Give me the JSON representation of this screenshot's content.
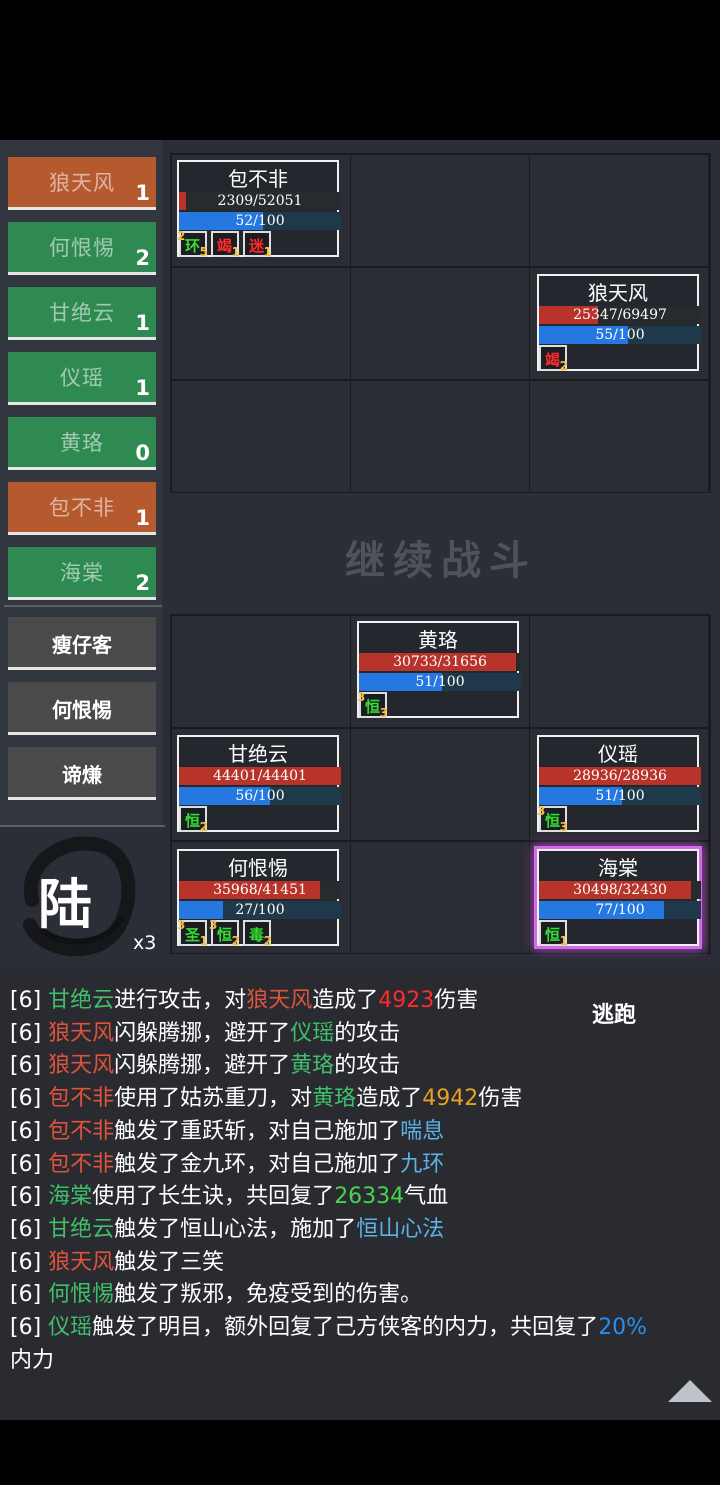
{
  "turn_order": [
    {
      "name": "狼天风",
      "count": "1",
      "side": "enemy"
    },
    {
      "name": "何恨惕",
      "count": "2",
      "side": "ally"
    },
    {
      "name": "甘绝云",
      "count": "1",
      "side": "ally"
    },
    {
      "name": "仪瑶",
      "count": "1",
      "side": "ally"
    },
    {
      "name": "黄珞",
      "count": "0",
      "side": "ally"
    },
    {
      "name": "包不非",
      "count": "1",
      "side": "enemy"
    },
    {
      "name": "海棠",
      "count": "2",
      "side": "ally"
    }
  ],
  "reserve": [
    {
      "name": "瘦仔客"
    },
    {
      "name": "何恨惕"
    },
    {
      "name": "谛熑"
    }
  ],
  "round": {
    "label": "陆",
    "multiplier": "x3"
  },
  "continue_label": "继续战斗",
  "flee_label": "逃跑",
  "colors": {
    "enemy_tab": "#b55a2f",
    "ally_tab": "#2f8a52",
    "hp_fill": "#b8342a",
    "mp_fill": "#2478e0",
    "active_glow": "#d56ae8",
    "enemy_name": "#e0533a",
    "ally_name": "#3fbf6a",
    "damage": "#ff2a2a",
    "number_orange": "#e8a020",
    "heal": "#49d24b",
    "buff_blue": "#5ab2e6"
  },
  "enemies": {
    "baobufei": {
      "name": "包不非",
      "hp": "2309/52051",
      "hp_frac": 0.044,
      "mp": "52/100",
      "mp_frac": 0.52,
      "buffs": [
        {
          "glyph": "环",
          "stack": "2",
          "dur": "5",
          "color": "#33dd33"
        },
        {
          "glyph": "竭",
          "stack": "",
          "dur": "1",
          "color": "#ff2a2a"
        },
        {
          "glyph": "迷",
          "stack": "",
          "dur": "1",
          "color": "#ff2a2a"
        }
      ]
    },
    "langtianfeng": {
      "name": "狼天风",
      "hp": "25347/69497",
      "hp_frac": 0.365,
      "mp": "55/100",
      "mp_frac": 0.55,
      "buffs": [
        {
          "glyph": "竭",
          "stack": "",
          "dur": "2",
          "color": "#ff2a2a"
        }
      ]
    }
  },
  "allies": {
    "huangluo": {
      "name": "黄珞",
      "hp": "30733/31656",
      "hp_frac": 0.971,
      "mp": "51/100",
      "mp_frac": 0.51,
      "buffs": [
        {
          "glyph": "恒",
          "stack": "3",
          "dur": "3",
          "color": "#33dd33"
        }
      ]
    },
    "ganjueyun": {
      "name": "甘绝云",
      "hp": "44401/44401",
      "hp_frac": 1.0,
      "mp": "56/100",
      "mp_frac": 0.56,
      "buffs": [
        {
          "glyph": "恒",
          "stack": "",
          "dur": "2",
          "color": "#33dd33"
        }
      ]
    },
    "yiyao": {
      "name": "仪瑶",
      "hp": "28936/28936",
      "hp_frac": 1.0,
      "mp": "51/100",
      "mp_frac": 0.51,
      "buffs": [
        {
          "glyph": "恒",
          "stack": "3",
          "dur": "3",
          "color": "#33dd33"
        }
      ]
    },
    "hehenti": {
      "name": "何恨惕",
      "hp": "35968/41451",
      "hp_frac": 0.868,
      "mp": "27/100",
      "mp_frac": 0.27,
      "buffs": [
        {
          "glyph": "圣",
          "stack": "3",
          "dur": "1",
          "color": "#33dd33"
        },
        {
          "glyph": "恒",
          "stack": "3",
          "dur": "2",
          "color": "#33dd33"
        },
        {
          "glyph": "毒",
          "stack": "",
          "dur": "2",
          "color": "#33dd33"
        }
      ]
    },
    "haitang": {
      "name": "海棠",
      "hp": "30498/32430",
      "hp_frac": 0.94,
      "mp": "77/100",
      "mp_frac": 0.77,
      "buffs": [
        {
          "glyph": "恒",
          "stack": "",
          "dur": "1",
          "color": "#33dd33"
        }
      ]
    }
  },
  "log": [
    [
      {
        "t": "[6] ",
        "c": "#ffffff"
      },
      {
        "t": "甘绝云",
        "c": "#3fbf6a"
      },
      {
        "t": "进行攻击，对",
        "c": "#ffffff"
      },
      {
        "t": "狼天风",
        "c": "#e0533a"
      },
      {
        "t": "造成了",
        "c": "#ffffff"
      },
      {
        "t": "4923",
        "c": "#ff2a2a"
      },
      {
        "t": "伤害",
        "c": "#ffffff"
      }
    ],
    [
      {
        "t": "[6] ",
        "c": "#ffffff"
      },
      {
        "t": "狼天风",
        "c": "#e0533a"
      },
      {
        "t": "闪躲腾挪，避开了",
        "c": "#ffffff"
      },
      {
        "t": "仪瑶",
        "c": "#3fbf6a"
      },
      {
        "t": "的攻击",
        "c": "#ffffff"
      }
    ],
    [
      {
        "t": "[6] ",
        "c": "#ffffff"
      },
      {
        "t": "狼天风",
        "c": "#e0533a"
      },
      {
        "t": "闪躲腾挪，避开了",
        "c": "#ffffff"
      },
      {
        "t": "黄珞",
        "c": "#3fbf6a"
      },
      {
        "t": "的攻击",
        "c": "#ffffff"
      }
    ],
    [
      {
        "t": "[6] ",
        "c": "#ffffff"
      },
      {
        "t": "包不非",
        "c": "#e0533a"
      },
      {
        "t": "使用了姑苏重刀，对",
        "c": "#ffffff"
      },
      {
        "t": "黄珞",
        "c": "#3fbf6a"
      },
      {
        "t": "造成了",
        "c": "#ffffff"
      },
      {
        "t": "4942",
        "c": "#e8a020"
      },
      {
        "t": "伤害",
        "c": "#ffffff"
      }
    ],
    [
      {
        "t": "[6] ",
        "c": "#ffffff"
      },
      {
        "t": "包不非",
        "c": "#e0533a"
      },
      {
        "t": "触发了重跃斩，对自己施加了",
        "c": "#ffffff"
      },
      {
        "t": "喘息",
        "c": "#5ab2e6"
      }
    ],
    [
      {
        "t": "[6] ",
        "c": "#ffffff"
      },
      {
        "t": "包不非",
        "c": "#e0533a"
      },
      {
        "t": "触发了金九环，对自己施加了",
        "c": "#ffffff"
      },
      {
        "t": "九环",
        "c": "#5ab2e6"
      }
    ],
    [
      {
        "t": "[6] ",
        "c": "#ffffff"
      },
      {
        "t": "海棠",
        "c": "#3fbf6a"
      },
      {
        "t": "使用了长生诀，共回复了",
        "c": "#ffffff"
      },
      {
        "t": "26334",
        "c": "#49d24b"
      },
      {
        "t": "气血",
        "c": "#ffffff"
      }
    ],
    [
      {
        "t": "[6] ",
        "c": "#ffffff"
      },
      {
        "t": "甘绝云",
        "c": "#3fbf6a"
      },
      {
        "t": "触发了恒山心法，施加了",
        "c": "#ffffff"
      },
      {
        "t": "恒山心法",
        "c": "#5ab2e6"
      }
    ],
    [
      {
        "t": "[6] ",
        "c": "#ffffff"
      },
      {
        "t": "狼天风",
        "c": "#e0533a"
      },
      {
        "t": "触发了三笑",
        "c": "#ffffff"
      }
    ],
    [
      {
        "t": "[6] ",
        "c": "#ffffff"
      },
      {
        "t": "何恨惕",
        "c": "#3fbf6a"
      },
      {
        "t": "触发了叛邪，免疫受到的伤害。",
        "c": "#ffffff"
      }
    ],
    [
      {
        "t": "[6] ",
        "c": "#ffffff"
      },
      {
        "t": "仪瑶",
        "c": "#3fbf6a"
      },
      {
        "t": "触发了明目，额外回复了己方侠客的内力，共回复了",
        "c": "#ffffff"
      },
      {
        "t": "20%",
        "c": "#2a8ef0"
      }
    ],
    [
      {
        "t": "内力",
        "c": "#ffffff"
      }
    ]
  ]
}
